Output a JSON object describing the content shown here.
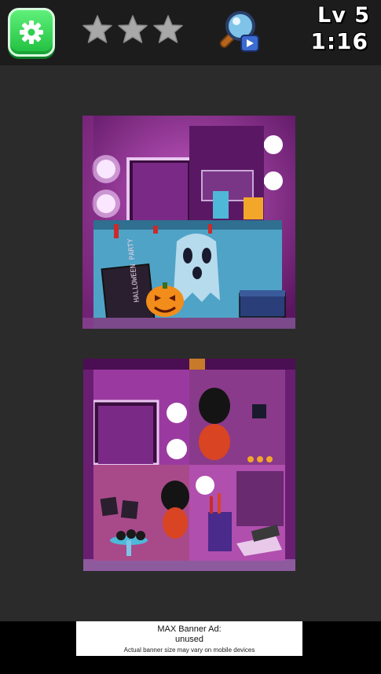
{
  "header": {
    "level_label": "Lv 5",
    "timer": "1:16",
    "stars_total": 3,
    "stars_earned": 0,
    "settings_icon": "gear-icon",
    "hint_icon": "magnifier-hint-icon"
  },
  "colors": {
    "settings_green": "#1fbf3f",
    "star_empty": "#a8a8a8",
    "scene_purple": "#8e2c8e",
    "tablecloth_blue": "#4fa3c7"
  },
  "ad_banner": {
    "title": "MAX Banner Ad:",
    "status": "unused",
    "note": "Actual banner size may vary on mobile devices"
  },
  "puzzle": {
    "reference_image_sign": "HALLOWEEN PARTY"
  }
}
